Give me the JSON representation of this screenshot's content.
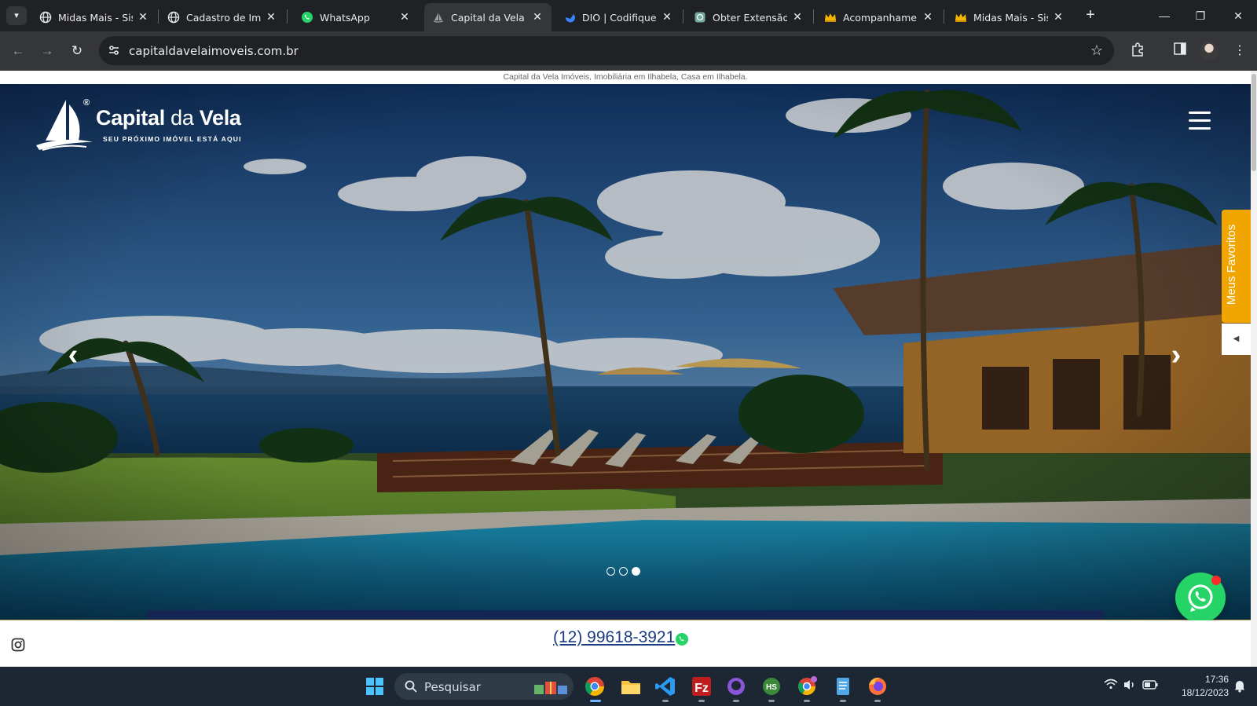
{
  "browser": {
    "tabs": [
      {
        "title": "Midas Mais - Sist",
        "icon": "globe-icon"
      },
      {
        "title": "Cadastro de Imó",
        "icon": "globe-icon"
      },
      {
        "title": "WhatsApp",
        "icon": "whatsapp-icon"
      },
      {
        "title": "Capital da Vela Ir",
        "icon": "sailboat-icon",
        "active": true
      },
      {
        "title": "DIO | Codifique o",
        "icon": "dio-icon"
      },
      {
        "title": "Obter Extensão",
        "icon": "extension-icon"
      },
      {
        "title": "Acompanhamen",
        "icon": "crown-icon"
      },
      {
        "title": "Midas Mais - Sist",
        "icon": "crown-icon"
      }
    ],
    "url": "capitaldavelaimoveis.com.br"
  },
  "page": {
    "seo_text": "Capital da Vela Imóveis, Imobiliária em Ilhabela, Casa em Ilhabela.",
    "logo": {
      "word_bold": "Capital",
      "word_thin": "da",
      "word_bold2": "Vela",
      "registered": "®",
      "tagline": "SEU PRÓXIMO IMÓVEL ESTÁ AQUI"
    },
    "favorites_label": "Meus Favoritos",
    "slider": {
      "count": 3,
      "active_index": 2
    },
    "phone": "(12) 99618-3921",
    "colors": {
      "accent": "#f0a500",
      "navy": "#152554",
      "whatsapp": "#25d366",
      "phone": "#1c3c82"
    }
  },
  "taskbar": {
    "search_placeholder": "Pesquisar",
    "time": "17:36",
    "date": "18/12/2023"
  }
}
